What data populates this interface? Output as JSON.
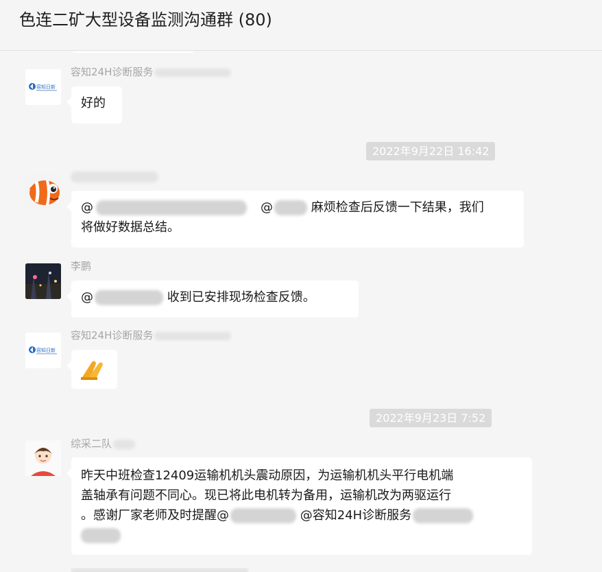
{
  "header": {
    "title": "色连二矿大型设备监测沟通群 (80)"
  },
  "messages": [
    {
      "sender": "容知24H诊断服务",
      "text": "好的"
    },
    {
      "timestamp": "2022年9月22日 16:42"
    },
    {
      "mention_prefix": "@",
      "mention2_prefix": "@",
      "text_line1": " 麻烦检查后反馈一下结果，我们",
      "text_line2": "将做好数据总结。"
    },
    {
      "sender": "李鹏",
      "mention_prefix": "@",
      "text": " 收到已安排现场检查反馈。"
    },
    {
      "sender": "容知24H诊断服务",
      "emoji": "folded-hands"
    },
    {
      "timestamp": "2022年9月23日 7:52"
    },
    {
      "sender": "综采二队",
      "text_line1": "昨天中班检查12409运输机机头震动原因，为运输机机头平行电机端",
      "text_line2": "盖轴承有问题不同心。现已将此电机转为备用，运输机改为两驱运行",
      "text_line3_prefix": "。感谢厂家老师及时提醒@",
      "text_line3_mid": " @容知24H诊断服务"
    }
  ],
  "logo_text": "容知日新",
  "colors": {
    "background": "#f5f5f5",
    "bubble": "#ffffff",
    "timestamp_bg": "#dadada",
    "sender": "#a6a6a6",
    "logo_blue": "#2a6fc4"
  }
}
